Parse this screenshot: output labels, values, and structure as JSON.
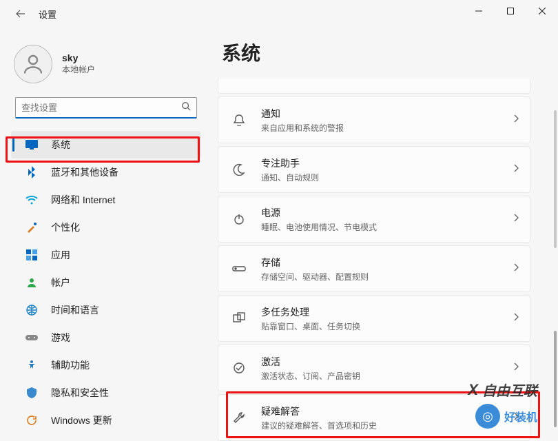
{
  "window": {
    "title": "设置"
  },
  "account": {
    "name": "sky",
    "type": "本地帐户"
  },
  "search": {
    "placeholder": "查找设置"
  },
  "sidebar": {
    "items": [
      {
        "label": "系统",
        "icon": "display"
      },
      {
        "label": "蓝牙和其他设备",
        "icon": "bluetooth"
      },
      {
        "label": "网络和 Internet",
        "icon": "wifi"
      },
      {
        "label": "个性化",
        "icon": "paint"
      },
      {
        "label": "应用",
        "icon": "apps"
      },
      {
        "label": "帐户",
        "icon": "person"
      },
      {
        "label": "时间和语言",
        "icon": "globe-clock"
      },
      {
        "label": "游戏",
        "icon": "gamepad"
      },
      {
        "label": "辅助功能",
        "icon": "accessibility"
      },
      {
        "label": "隐私和安全性",
        "icon": "shield"
      },
      {
        "label": "Windows 更新",
        "icon": "update"
      }
    ]
  },
  "page": {
    "title": "系统"
  },
  "cards": [
    {
      "title": "通知",
      "sub": "来自应用和系统的警报",
      "icon": "bell"
    },
    {
      "title": "专注助手",
      "sub": "通知、自动规则",
      "icon": "moon"
    },
    {
      "title": "电源",
      "sub": "睡眠、电池使用情况、节电模式",
      "icon": "power"
    },
    {
      "title": "存储",
      "sub": "存储空间、驱动器、配置规则",
      "icon": "storage"
    },
    {
      "title": "多任务处理",
      "sub": "贴靠窗口、桌面、任务切换",
      "icon": "multitask"
    },
    {
      "title": "激活",
      "sub": "激活状态、订阅、产品密钥",
      "icon": "check-circle"
    },
    {
      "title": "疑难解答",
      "sub": "建议的疑难解答、首选项和历史",
      "icon": "wrench"
    }
  ],
  "watermark": {
    "brand1": "自由互联",
    "brand2": "好装机"
  }
}
